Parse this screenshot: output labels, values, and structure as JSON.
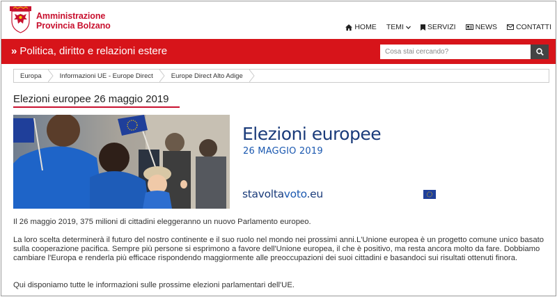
{
  "brand": {
    "line1": "Amministrazione",
    "line2": "Provincia Bolzano"
  },
  "nav": {
    "home": "HOME",
    "temi": "TEMI",
    "servizi": "SERVIZI",
    "news": "NEWS",
    "contatti": "CONTATTI"
  },
  "section": {
    "title": "Politica, diritto e relazioni estere"
  },
  "search": {
    "placeholder": "Cosa stai cercando?"
  },
  "breadcrumb": [
    "Europa",
    "Informazioni UE - Europe Direct",
    "Europe Direct Alto Adige"
  ],
  "page": {
    "title": "Elezioni europee 26 maggio 2019"
  },
  "promo": {
    "title": "Elezioni europee",
    "date": "26 MAGGIO 2019",
    "url_part1": "stavolta",
    "url_part2": "voto",
    "url_part3": ".eu"
  },
  "paragraphs": [
    "Il 26 maggio 2019, 375 milioni di cittadini eleggeranno un nuovo Parlamento europeo.",
    "La loro scelta determinerà il futuro del nostro continente e il suo ruolo nel mondo nei prossimi anni.L'Unione europea è un progetto comune unico basato sulla cooperazione pacifica. Sempre più persone si esprimono a favore dell'Unione europea, il che è positivo, ma resta ancora molto da fare. Dobbiamo cambiare l'Europa e renderla più efficace rispondendo maggiormente alle preoccupazioni dei suoi cittadini e basandoci sui risultati ottenuti finora.",
    "Qui disponiamo tutte le informazioni sulle prossime elezioni parlamentari dell'UE."
  ],
  "colors": {
    "brand_red": "#d7141a",
    "eu_blue": "#1a3b7a",
    "eu_yellow": "#ffcc00"
  },
  "icons": [
    "coat-of-arms-logo",
    "home-icon",
    "chevron-down-icon",
    "bookmark-icon",
    "newspaper-icon",
    "envelope-icon",
    "search-icon",
    "eu-flag-icon"
  ]
}
